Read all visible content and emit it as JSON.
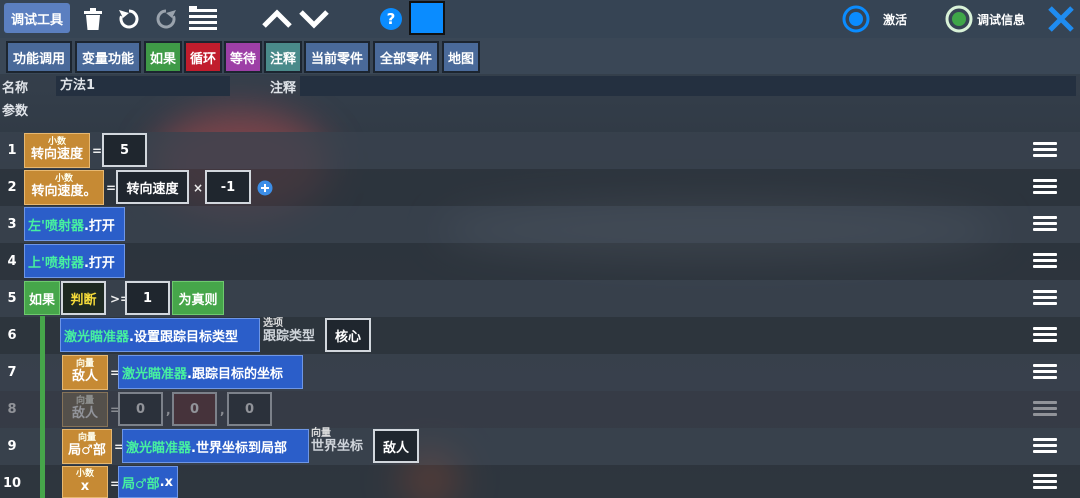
{
  "toolbar": {
    "tools_label": "调试工具",
    "activate_label": "激活",
    "debug_info_label": "调试信息",
    "accent": "#0a8cff"
  },
  "categories": [
    {
      "label": "功能调用",
      "color": "#4a6a9a"
    },
    {
      "label": "变量功能",
      "color": "#4a6a9a"
    },
    {
      "label": "如果",
      "color": "#3f9a47"
    },
    {
      "label": "循环",
      "color": "#c11d2d"
    },
    {
      "label": "等待",
      "color": "#9d3fa6"
    },
    {
      "label": "注释",
      "color": "#4a8a8a"
    },
    {
      "label": "当前零件",
      "color": "#4a6a9a"
    },
    {
      "label": "全部零件",
      "color": "#4a6a9a"
    },
    {
      "label": "地图",
      "color": "#4a6a9a"
    }
  ],
  "method": {
    "name_label": "名称",
    "name_value": "方法1",
    "comment_label": "注释",
    "params_label": "参数"
  },
  "lines": [
    "1",
    "2",
    "3",
    "4",
    "5",
    "6",
    "7",
    "8",
    "9",
    "10"
  ],
  "code": {
    "l1": {
      "type": "小数",
      "name": "转向速度",
      "eq": "=",
      "value": "5"
    },
    "l2": {
      "type": "小数",
      "name": "转向速度。",
      "eq": "=",
      "var": "转向速度",
      "op": "×",
      "value": "-1"
    },
    "l3": {
      "obj": "左'喷射器",
      "method": ".打开"
    },
    "l4": {
      "obj": "上'喷射器",
      "method": ".打开"
    },
    "l5": {
      "if": "如果",
      "judge": "判断",
      "op": ">=",
      "value": "1",
      "then": "为真则"
    },
    "l6": {
      "obj": "激光瞄准器",
      "method": ".设置跟踪目标类型",
      "opt_title": "选项",
      "opt_name": "跟踪类型",
      "opt_value": "核心"
    },
    "l7": {
      "type": "向量",
      "name": "敌人",
      "eq": "=",
      "obj": "激光瞄准器",
      "method": ".跟踪目标的坐标"
    },
    "l8": {
      "type": "向量",
      "name": "敌人",
      "eq": "=",
      "x": "0",
      "sep1": ",",
      "y": "0",
      "sep2": ",",
      "z": "0"
    },
    "l9": {
      "type": "向量",
      "name": "局♂部",
      "eq": "=",
      "obj": "激光瞄准器",
      "method": ".世界坐标到局部",
      "arg_title": "向量",
      "arg_name": "世界坐标",
      "arg_value": "敌人"
    },
    "l10": {
      "type": "小数",
      "name": "x",
      "eq": "=",
      "obj": "局♂部",
      "method": ".x"
    }
  }
}
